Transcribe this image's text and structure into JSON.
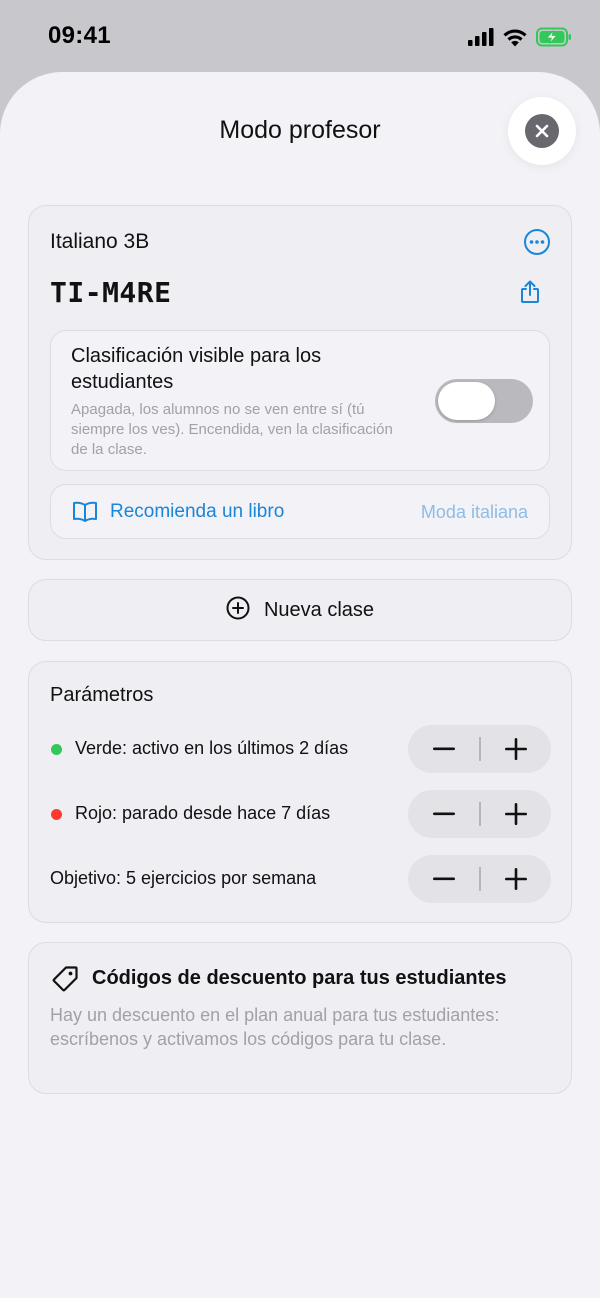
{
  "status_bar": {
    "time": "09:41",
    "icons": [
      "cellular-signal-icon",
      "wifi-icon",
      "battery-charging-icon"
    ],
    "battery_color": "#34c759"
  },
  "sheet": {
    "title": "Modo profesor",
    "close_icon": "close-icon"
  },
  "class_card": {
    "name": "Italiano 3B",
    "code": "TI-M4RE",
    "more_icon": "ellipsis-circle-icon",
    "share_icon": "share-icon",
    "leaderboard": {
      "title": "Clasificación visible para los estudiantes",
      "description": "Apagada, los alumnos no se ven entre sí (tú siempre los ves). Encendida, ven la clasificación de la clase.",
      "enabled": false
    },
    "book": {
      "icon": "book-icon",
      "label": "Recomienda un libro",
      "value": "Moda italiana"
    }
  },
  "new_class": {
    "icon": "plus-circle-icon",
    "label": "Nueva clase"
  },
  "parameters": {
    "title": "Parámetros",
    "rows": [
      {
        "label": "Verde: activo en los últimos 2 días",
        "dot_color": "#34c759"
      },
      {
        "label": "Rojo: parado desde hace 7 días",
        "dot_color": "#ff3b30"
      },
      {
        "label": "Objetivo: 5 ejercicios por semana",
        "dot_color": ""
      }
    ]
  },
  "discount": {
    "icon": "tag-icon",
    "title": "Códigos de descuento para tus estudiantes",
    "description": "Hay un descuento en el plan anual para tus estudiantes: escríbenos y activamos los códigos para tu clase."
  },
  "colors": {
    "accent": "#1a86d7",
    "accent_light": "#8cbde8",
    "background": "#f2f2f7",
    "secondary_text": "#a1a1a6"
  }
}
